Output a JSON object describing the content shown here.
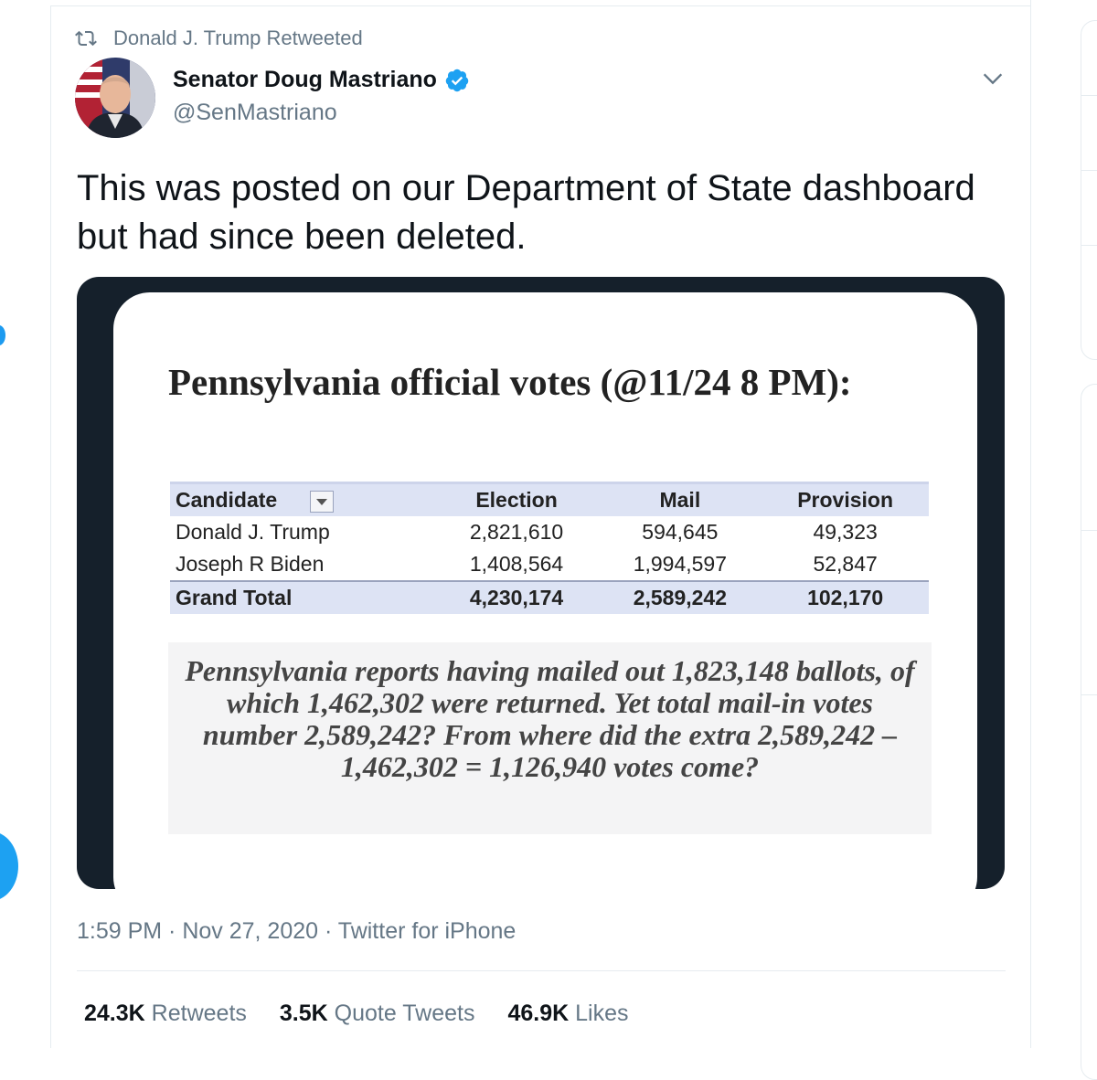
{
  "retweet_label": "Donald J. Trump Retweeted",
  "author": {
    "display_name": "Senator Doug Mastriano",
    "handle": "@SenMastriano",
    "verified": true
  },
  "tweet_text": "This was posted on our Department of State dashboard but had since been deleted.",
  "media": {
    "title": "Pennsylvania official votes (@11/24 8 PM):",
    "table": {
      "headers": [
        "Candidate",
        "Election",
        "Mail",
        "Provision"
      ],
      "rows": [
        [
          "Donald J. Trump",
          "2,821,610",
          "594,645",
          "49,323"
        ],
        [
          "Joseph R Biden",
          "1,408,564",
          "1,994,597",
          "52,847"
        ]
      ],
      "total": [
        "Grand Total",
        "4,230,174",
        "2,589,242",
        "102,170"
      ]
    },
    "caption": "Pennsylvania reports having mailed out 1,823,148 ballots, of which 1,462,302 were returned. Yet total mail-in votes number 2,589,242? From where did the extra 2,589,242 – 1,462,302 = 1,126,940 votes come?"
  },
  "meta": "1:59 PM · Nov 27, 2020 · Twitter for iPhone",
  "stats": {
    "retweets": {
      "count": "24.3K",
      "label": "Retweets"
    },
    "quote_tweets": {
      "count": "3.5K",
      "label": "Quote Tweets"
    },
    "likes": {
      "count": "46.9K",
      "label": "Likes"
    }
  },
  "colors": {
    "accent": "#1da1f2",
    "secondary_text": "#657786",
    "media_bg": "#15202b"
  }
}
